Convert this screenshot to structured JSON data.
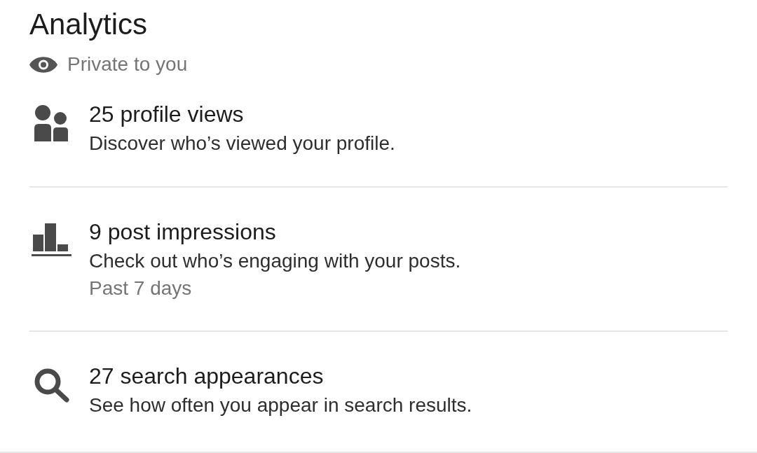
{
  "header": {
    "title": "Analytics",
    "visibility": "Private to you"
  },
  "items": [
    {
      "kind": "people",
      "title": "25 profile views",
      "description": "Discover who’s viewed your profile."
    },
    {
      "kind": "chart",
      "title": "9 post impressions",
      "description": "Check out who’s engaging with your posts.",
      "period": "Past 7 days"
    },
    {
      "kind": "search",
      "title": "27 search appearances",
      "description": "See how often you appear in search results."
    }
  ]
}
